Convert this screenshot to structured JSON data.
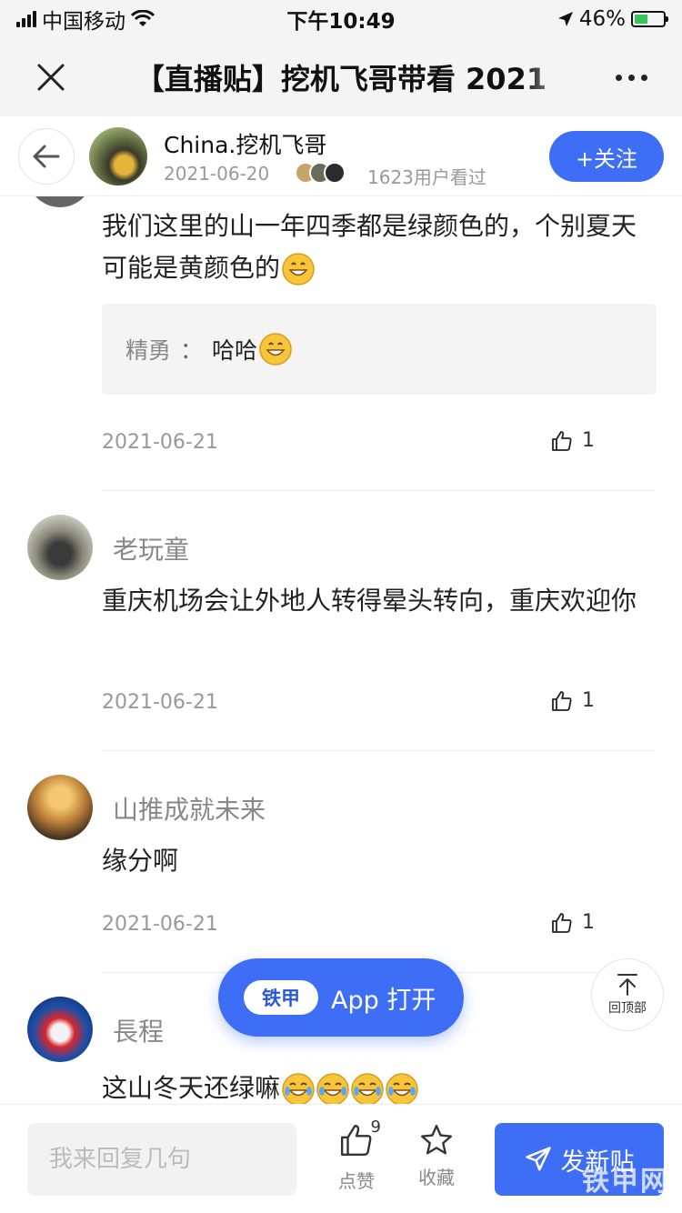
{
  "status_bar": {
    "carrier": "中国移动",
    "time": "下午10:49",
    "battery": "46%",
    "battery_level": 0.46
  },
  "title_bar": {
    "title": "【直播贴】挖机飞哥带看 2021"
  },
  "author": {
    "name": "China.挖机飞哥",
    "date": "2021-06-20",
    "viewers": "1623用户看过",
    "follow_label": "+关注"
  },
  "comments": [
    {
      "text": "我们这里的山一年四季都是绿颜色的，个别夏天可能是黄颜色的",
      "reply": {
        "author": "精勇",
        "separator": "：",
        "text": "哈哈"
      },
      "date": "2021-06-21",
      "likes": "1"
    },
    {
      "name": "老玩童",
      "text": "重庆机场会让外地人转得晕头转向，重庆欢迎你",
      "date": "2021-06-21",
      "likes": "1"
    },
    {
      "name": "山推成就未来",
      "text": "缘分啊",
      "date": "2021-06-21",
      "likes": "1"
    },
    {
      "name": "長程",
      "text": "这山冬天还绿嘛"
    }
  ],
  "floating": {
    "app_logo": "铁甲",
    "open_app_label": "App 打开",
    "back_to_top_label": "回顶部"
  },
  "bottom_bar": {
    "reply_placeholder": "我来回复几句",
    "like_label": "点赞",
    "like_count": "9",
    "favorite_label": "收藏",
    "post_label": "发新贴"
  },
  "watermark": "铁甲网",
  "colors": {
    "accent": "#3d6ef5",
    "battery_green": "#35c759"
  }
}
